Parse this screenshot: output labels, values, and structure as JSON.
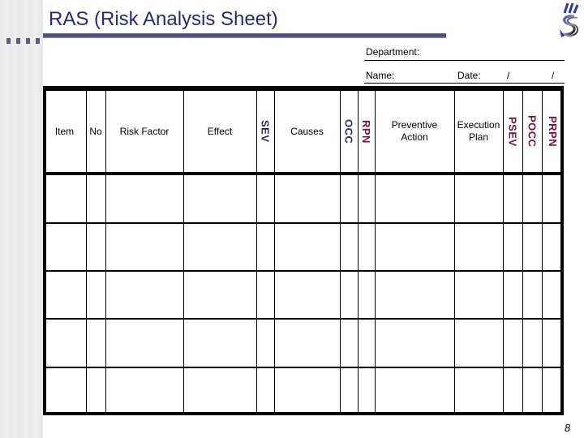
{
  "slide": {
    "title": "RAS (Risk Analysis Sheet)",
    "page_number": "8",
    "logo_icon": "company-logo-icon"
  },
  "form": {
    "department_label": "Department:",
    "name_label": "Name:",
    "date_label": "Date:",
    "date_separator_1": "/",
    "date_separator_2": "/"
  },
  "table": {
    "columns": [
      {
        "label": "Item",
        "orientation": "horizontal"
      },
      {
        "label": "No",
        "orientation": "horizontal"
      },
      {
        "label": "Risk Factor",
        "orientation": "horizontal"
      },
      {
        "label": "Effect",
        "orientation": "horizontal"
      },
      {
        "label": "SEV",
        "orientation": "vertical",
        "color": "#2b2b63"
      },
      {
        "label": "Causes",
        "orientation": "horizontal"
      },
      {
        "label": "OCC",
        "orientation": "vertical",
        "color": "#2b2b63"
      },
      {
        "label": "RPN",
        "orientation": "vertical",
        "color": "#7a1040"
      },
      {
        "label": "Preventive Action",
        "orientation": "horizontal"
      },
      {
        "label": "Execution Plan",
        "orientation": "horizontal"
      },
      {
        "label": "PSEV",
        "orientation": "vertical",
        "color": "#7a1040"
      },
      {
        "label": "POCC",
        "orientation": "vertical",
        "color": "#7a1040"
      },
      {
        "label": "PRPN",
        "orientation": "vertical",
        "color": "#7a1040"
      }
    ],
    "rows": [
      [
        "",
        "",
        "",
        "",
        "",
        "",
        "",
        "",
        "",
        "",
        "",
        "",
        ""
      ],
      [
        "",
        "",
        "",
        "",
        "",
        "",
        "",
        "",
        "",
        "",
        "",
        "",
        ""
      ],
      [
        "",
        "",
        "",
        "",
        "",
        "",
        "",
        "",
        "",
        "",
        "",
        "",
        ""
      ],
      [
        "",
        "",
        "",
        "",
        "",
        "",
        "",
        "",
        "",
        "",
        "",
        "",
        ""
      ],
      [
        "",
        "",
        "",
        "",
        "",
        "",
        "",
        "",
        "",
        "",
        "",
        "",
        ""
      ]
    ]
  },
  "colors": {
    "title": "#2a2a6e",
    "accent_rule": "#3c3b78",
    "navy_header": "#2b2b63",
    "maroon_header": "#7a1040"
  }
}
